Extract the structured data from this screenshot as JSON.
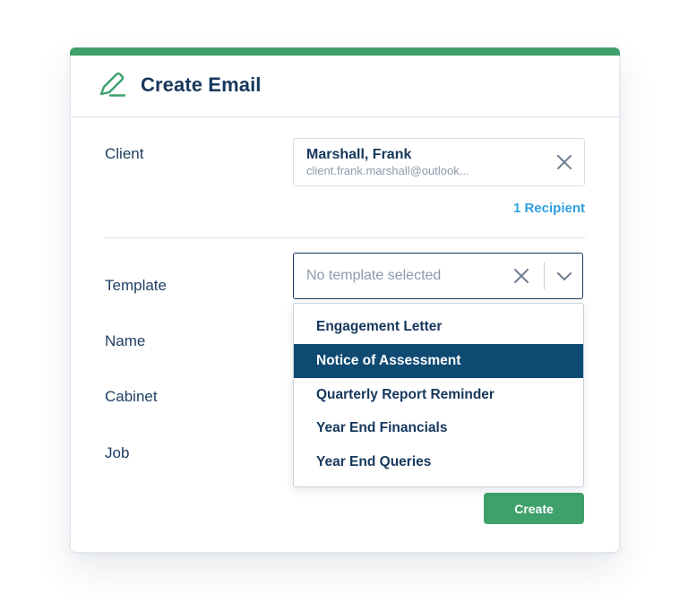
{
  "header": {
    "title": "Create Email",
    "icon": "pen-icon",
    "accent_color": "#3ea06b"
  },
  "client": {
    "label": "Client",
    "name": "Marshall, Frank",
    "email": "client.frank.marshall@outlook...",
    "recipient_link": "1 Recipient"
  },
  "template": {
    "label": "Template",
    "placeholder": "No template selected",
    "options": [
      "Engagement Letter",
      "Notice of Assessment",
      "Quarterly Report Reminder",
      "Year End Financials",
      "Year End Queries"
    ],
    "highlighted": "Notice of Assessment"
  },
  "fields": {
    "name_label": "Name",
    "cabinet_label": "Cabinet",
    "job_label": "Job"
  },
  "actions": {
    "create_label": "Create"
  }
}
